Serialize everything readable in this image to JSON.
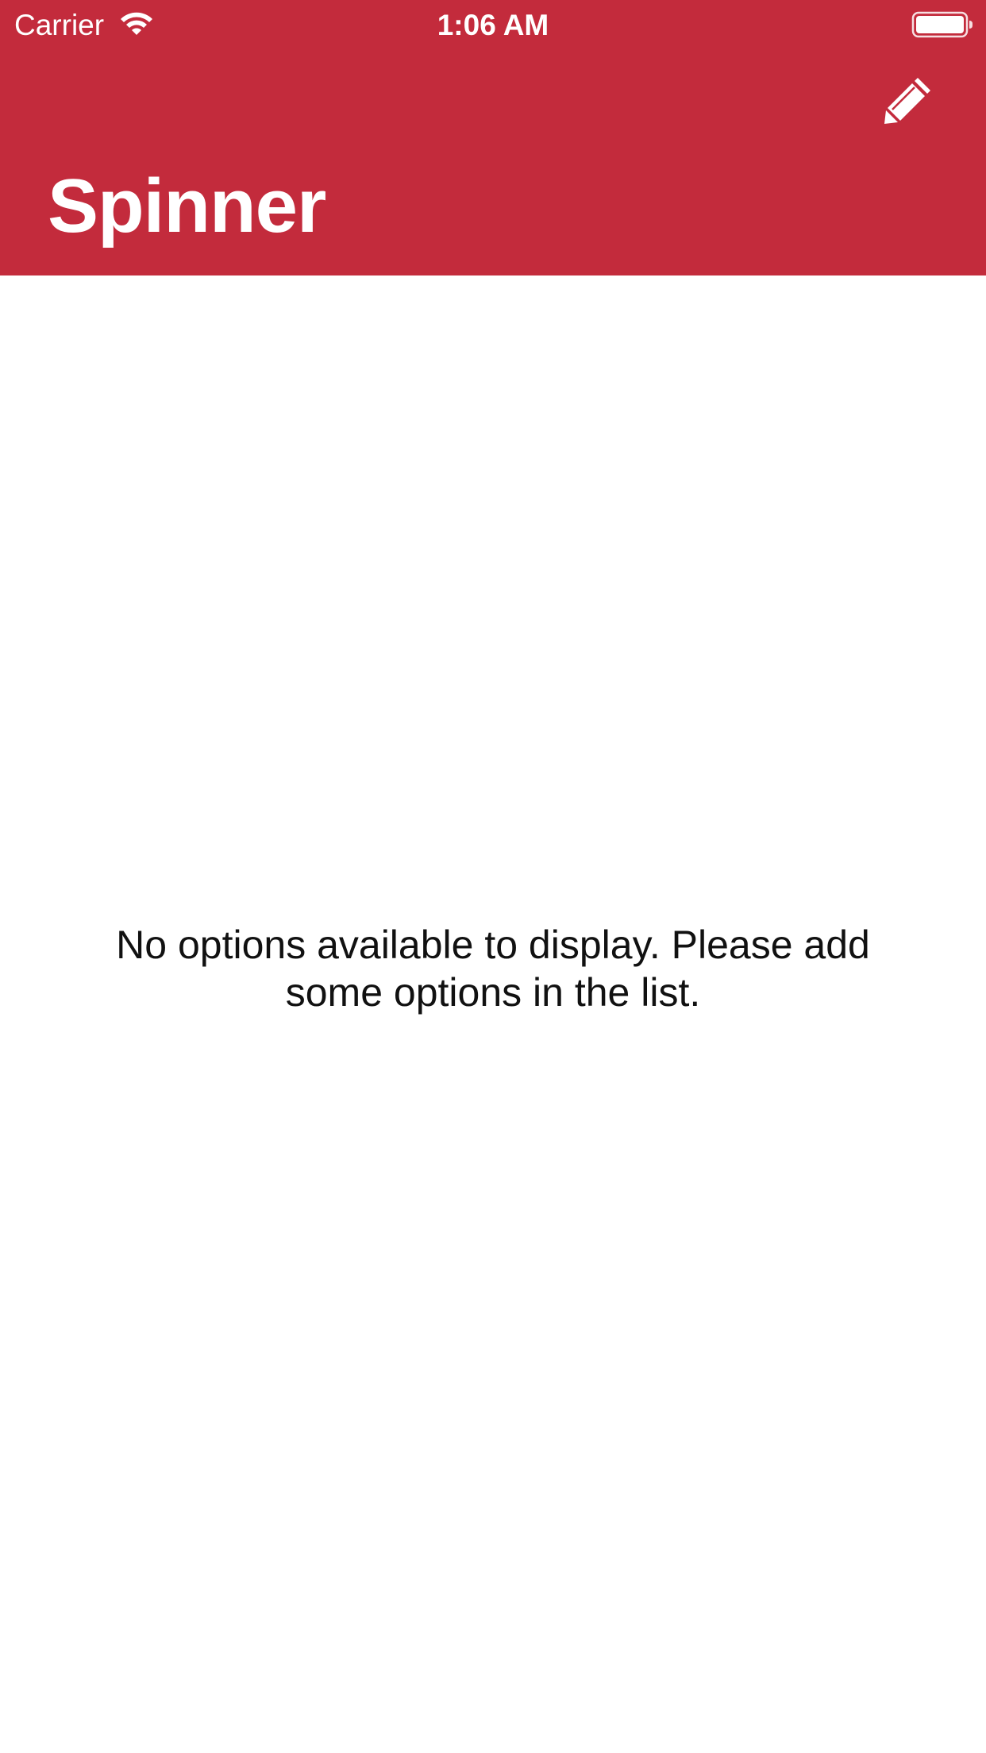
{
  "colors": {
    "header_bg": "#c32b3c",
    "header_text": "#ffffff",
    "body_bg": "#ffffff",
    "message_text": "#111111"
  },
  "status_bar": {
    "carrier": "Carrier",
    "time": "1:06 AM",
    "wifi_icon": "wifi-icon",
    "battery_icon": "battery-full-icon"
  },
  "nav": {
    "title": "Spinner",
    "edit_icon": "pencil-icon"
  },
  "content": {
    "empty_message": "No options available to display. Please add some options in the list."
  }
}
